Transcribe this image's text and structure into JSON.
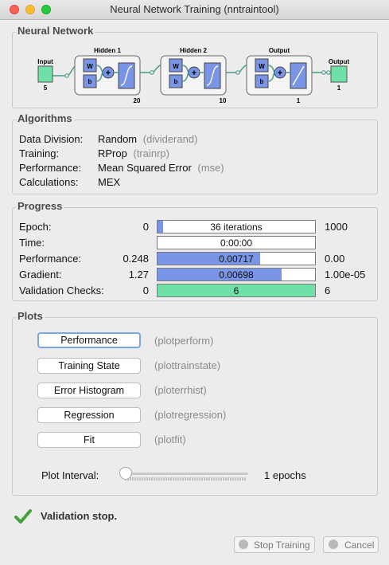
{
  "window": {
    "title": "Neural Network Training (nntraintool)"
  },
  "network": {
    "section_title": "Neural Network",
    "input_label": "Input",
    "input_size": "5",
    "hidden1_label": "Hidden 1",
    "hidden1_size": "20",
    "hidden2_label": "Hidden 2",
    "hidden2_size": "10",
    "output_layer_label": "Output",
    "output_layer_size": "1",
    "output_label": "Output",
    "output_size": "1",
    "weight_label": "W",
    "bias_label": "b",
    "sum_symbol": "+"
  },
  "algorithms": {
    "section_title": "Algorithms",
    "rows": [
      {
        "label": "Data Division:",
        "value": "Random",
        "detail": "(dividerand)"
      },
      {
        "label": "Training:",
        "value": "RProp",
        "detail": "(trainrp)"
      },
      {
        "label": "Performance:",
        "value": "Mean Squared Error",
        "detail": "(mse)"
      },
      {
        "label": "Calculations:",
        "value": "MEX",
        "detail": ""
      }
    ]
  },
  "progress": {
    "section_title": "Progress",
    "rows": [
      {
        "label": "Epoch:",
        "start": "0",
        "text": "36 iterations",
        "end": "1000",
        "fill": 0.036
      },
      {
        "label": "Time:",
        "start": "",
        "text": "0:00:00",
        "end": "",
        "fill": 0
      },
      {
        "label": "Performance:",
        "start": "0.248",
        "text": "0.00717",
        "end": "0.00",
        "fill": 0.65
      },
      {
        "label": "Gradient:",
        "start": "1.27",
        "text": "0.00698",
        "end": "1.00e-05",
        "fill": 0.79
      },
      {
        "label": "Validation Checks:",
        "start": "0",
        "text": "6",
        "end": "6",
        "fill": 1.0
      }
    ]
  },
  "plots": {
    "section_title": "Plots",
    "buttons": [
      {
        "label": "Performance",
        "fn": "(plotperform)"
      },
      {
        "label": "Training State",
        "fn": "(plottrainstate)"
      },
      {
        "label": "Error Histogram",
        "fn": "(ploterrhist)"
      },
      {
        "label": "Regression",
        "fn": "(plotregression)"
      },
      {
        "label": "Fit",
        "fn": "(plotfit)"
      }
    ],
    "interval_label": "Plot Interval:",
    "interval_value": "1 epochs"
  },
  "status": {
    "message": "Validation stop.",
    "icon": "check-icon",
    "color": "#3fa33a"
  },
  "footer": {
    "stop_label": "Stop Training",
    "cancel_label": "Cancel"
  }
}
